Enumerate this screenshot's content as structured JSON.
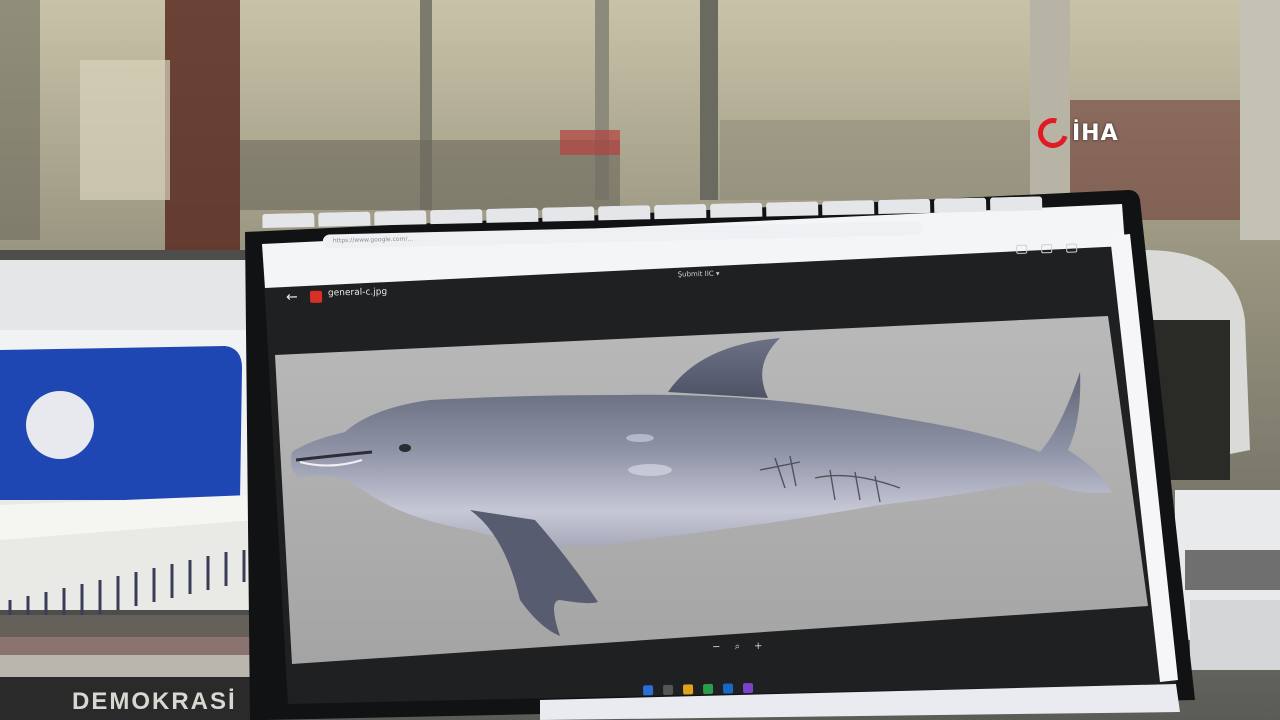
{
  "watermark": {
    "brand": "İHA",
    "logo_color": "#e01b24"
  },
  "book": {
    "title": "DEMOKRASİ"
  },
  "screen": {
    "file_name": "general-c.jpg",
    "viewer_title": "Şubmit IIC ▾",
    "address": "https://www.google.com/...",
    "tabs": [
      "",
      "",
      "",
      "",
      "",
      "",
      "",
      "",
      "",
      "",
      "",
      "",
      "",
      ""
    ],
    "zoom": {
      "minus": "−",
      "search": "⌕",
      "plus": "+"
    }
  },
  "colors": {
    "screen_bg": "#1f2022",
    "viewer_gray": "#aeaeae",
    "dolphin": "#8c90a3"
  }
}
